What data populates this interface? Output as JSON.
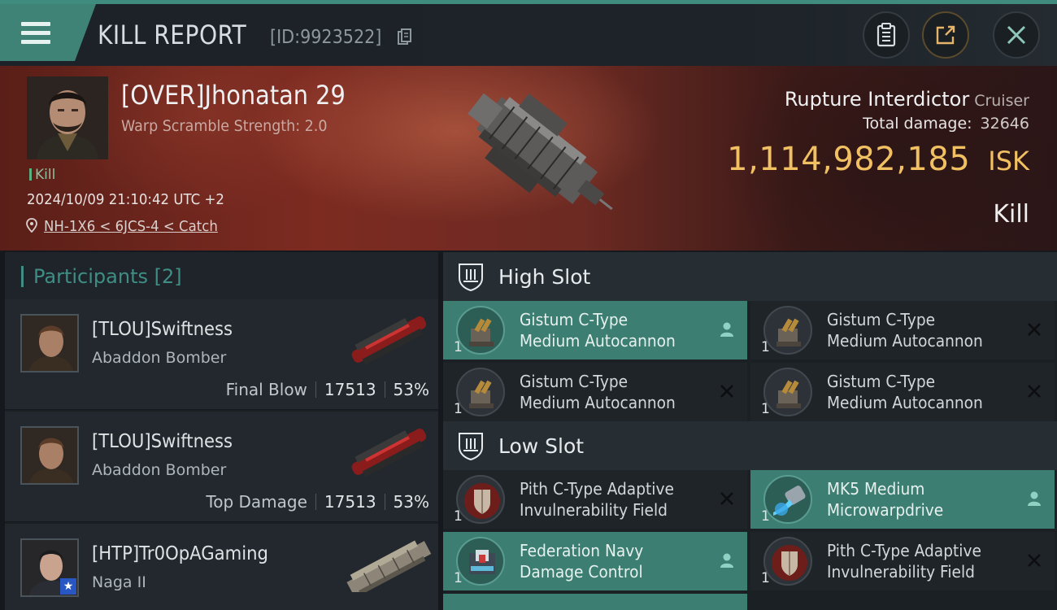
{
  "header": {
    "title": "KILL REPORT",
    "report_id": "[ID:9923522]",
    "icons": [
      "menu-icon",
      "copy-icon",
      "clipboard-icon",
      "share-icon",
      "close-icon"
    ]
  },
  "victim": {
    "name": "[OVER]Jhonatan 29",
    "warp_scramble": "Warp Scramble Strength: 2.0",
    "status_small": "Kill",
    "timestamp": "2024/10/09 21:10:42 UTC +2",
    "location": "NH-1X6 < 6JCS-4 < Catch",
    "ship_name": "Rupture Interdictor",
    "ship_class": "Cruiser",
    "total_damage_label": "Total damage:",
    "total_damage": "32646",
    "isk_value": "1,114,982,185",
    "isk_unit": "ISK",
    "result": "Kill"
  },
  "participants": {
    "header": "Participants [2]",
    "rows": [
      {
        "name": "[TLOU]Swiftness",
        "ship": "Abaddon Bomber",
        "tag": "Final Blow",
        "damage": "17513",
        "percent": "53%"
      },
      {
        "name": "[TLOU]Swiftness",
        "ship": "Abaddon Bomber",
        "tag": "Top Damage",
        "damage": "17513",
        "percent": "53%"
      },
      {
        "name": "[HTP]Tr0OpAGaming",
        "ship": "Naga II"
      }
    ]
  },
  "fitting": {
    "high_slot_label": "High Slot",
    "low_slot_label": "Low Slot",
    "high": [
      {
        "qty": "1",
        "line1": "Gistum C-Type",
        "line2": "Medium Autocannon",
        "status": "dropped"
      },
      {
        "qty": "1",
        "line1": "Gistum C-Type",
        "line2": "Medium Autocannon",
        "status": "destroyed"
      },
      {
        "qty": "1",
        "line1": "Gistum C-Type",
        "line2": "Medium Autocannon",
        "status": "destroyed"
      },
      {
        "qty": "1",
        "line1": "Gistum C-Type",
        "line2": "Medium Autocannon",
        "status": "destroyed"
      }
    ],
    "low": [
      {
        "qty": "1",
        "line1": "Pith C-Type Adaptive",
        "line2": "Invulnerability Field",
        "status": "destroyed"
      },
      {
        "qty": "1",
        "line1": "MK5 Medium",
        "line2": "Microwarpdrive",
        "status": "dropped"
      },
      {
        "qty": "1",
        "line1": "Federation Navy",
        "line2": "Damage Control",
        "status": "dropped"
      },
      {
        "qty": "1",
        "line1": "Pith C-Type Adaptive",
        "line2": "Invulnerability Field",
        "status": "destroyed"
      }
    ]
  },
  "colors": {
    "accent": "#3f8276",
    "isk_gold": "#f1c063",
    "dropped_bg": "#3c7e72",
    "participants_teal": "#3f8e85"
  }
}
